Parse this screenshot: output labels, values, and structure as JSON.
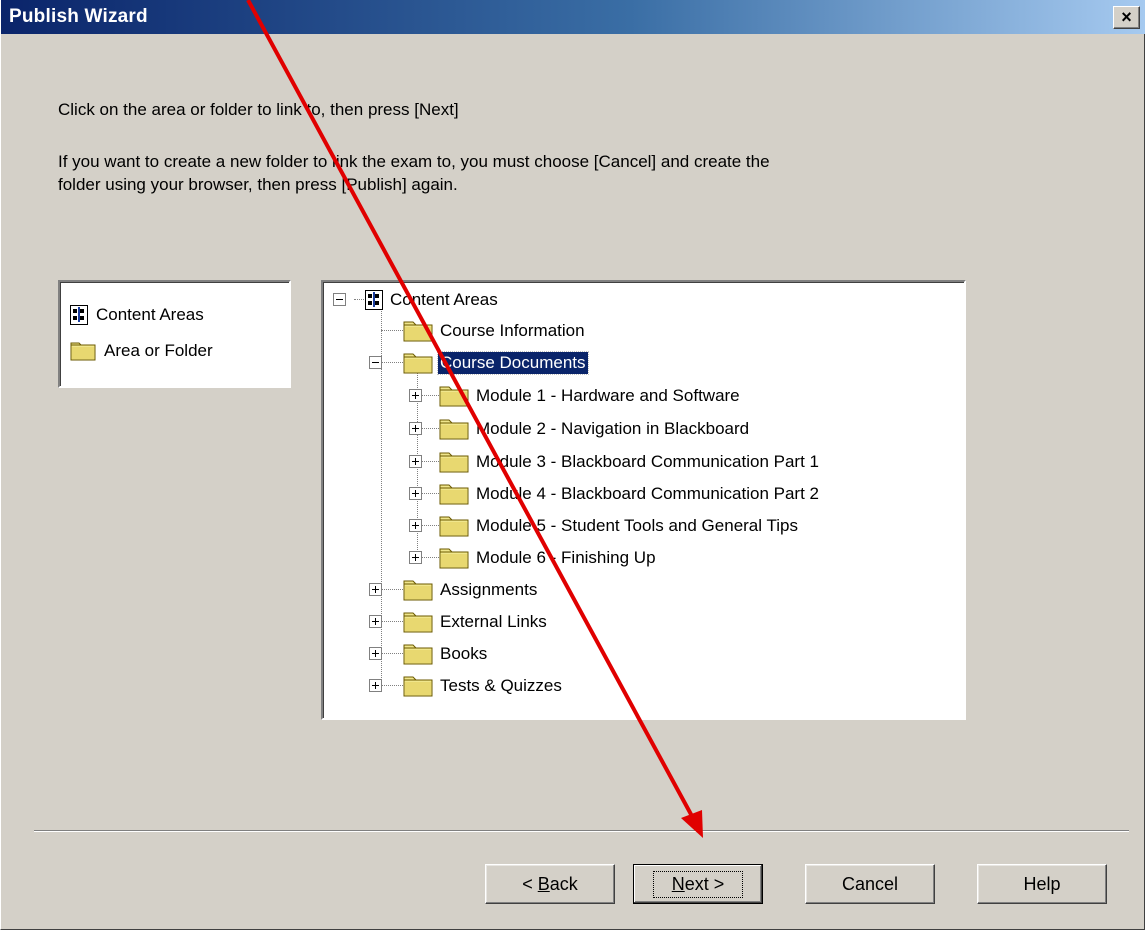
{
  "window": {
    "title": "Publish Wizard",
    "close_label": "×"
  },
  "instructions": {
    "line1": "Click on the area or folder to link to, then press [Next]",
    "line2": "If you want to create a new folder to link the exam to, you must choose [Cancel] and create the",
    "line3": "folder using your browser, then press [Publish] again."
  },
  "legend": {
    "items": [
      {
        "icon": "content-areas-icon",
        "label": "Content Areas"
      },
      {
        "icon": "folder-icon",
        "label": "Area or Folder"
      }
    ]
  },
  "tree": {
    "root": {
      "label": "Content Areas",
      "expanded": true
    },
    "nodes": [
      {
        "label": "Course Information",
        "level": 1,
        "expander": "none",
        "selected": false
      },
      {
        "label": "Course Documents",
        "level": 1,
        "expander": "minus",
        "selected": true
      },
      {
        "label": "Module 1 - Hardware and Software",
        "level": 2,
        "expander": "plus",
        "selected": false
      },
      {
        "label": "Module 2 - Navigation in Blackboard",
        "level": 2,
        "expander": "plus",
        "selected": false
      },
      {
        "label": "Module 3 - Blackboard Communication Part 1",
        "level": 2,
        "expander": "plus",
        "selected": false
      },
      {
        "label": "Module 4 - Blackboard Communication Part 2",
        "level": 2,
        "expander": "plus",
        "selected": false
      },
      {
        "label": "Module 5 - Student Tools and General Tips",
        "level": 2,
        "expander": "plus",
        "selected": false
      },
      {
        "label": "Module 6 - Finishing Up",
        "level": 2,
        "expander": "plus",
        "selected": false
      },
      {
        "label": "Assignments",
        "level": 1,
        "expander": "plus",
        "selected": false
      },
      {
        "label": "External Links",
        "level": 1,
        "expander": "plus",
        "selected": false
      },
      {
        "label": "Books",
        "level": 1,
        "expander": "plus",
        "selected": false
      },
      {
        "label": "Tests & Quizzes",
        "level": 1,
        "expander": "plus",
        "selected": false
      }
    ]
  },
  "buttons": {
    "back": {
      "prefix": "< ",
      "mnemonic": "B",
      "rest": "ack"
    },
    "next": {
      "mnemonic": "N",
      "rest": "ext",
      "suffix": " >"
    },
    "cancel": "Cancel",
    "help": "Help"
  },
  "colors": {
    "titlebar_start": "#0a246a",
    "titlebar_end": "#a6caf0",
    "dialog_face": "#d4d0c8",
    "selection": "#0a246a",
    "folder_fill": "#f0e68c",
    "annotation_arrow": "#e00000"
  },
  "annotation": {
    "arrow_color": "#e00000",
    "description_target": "next-button"
  }
}
